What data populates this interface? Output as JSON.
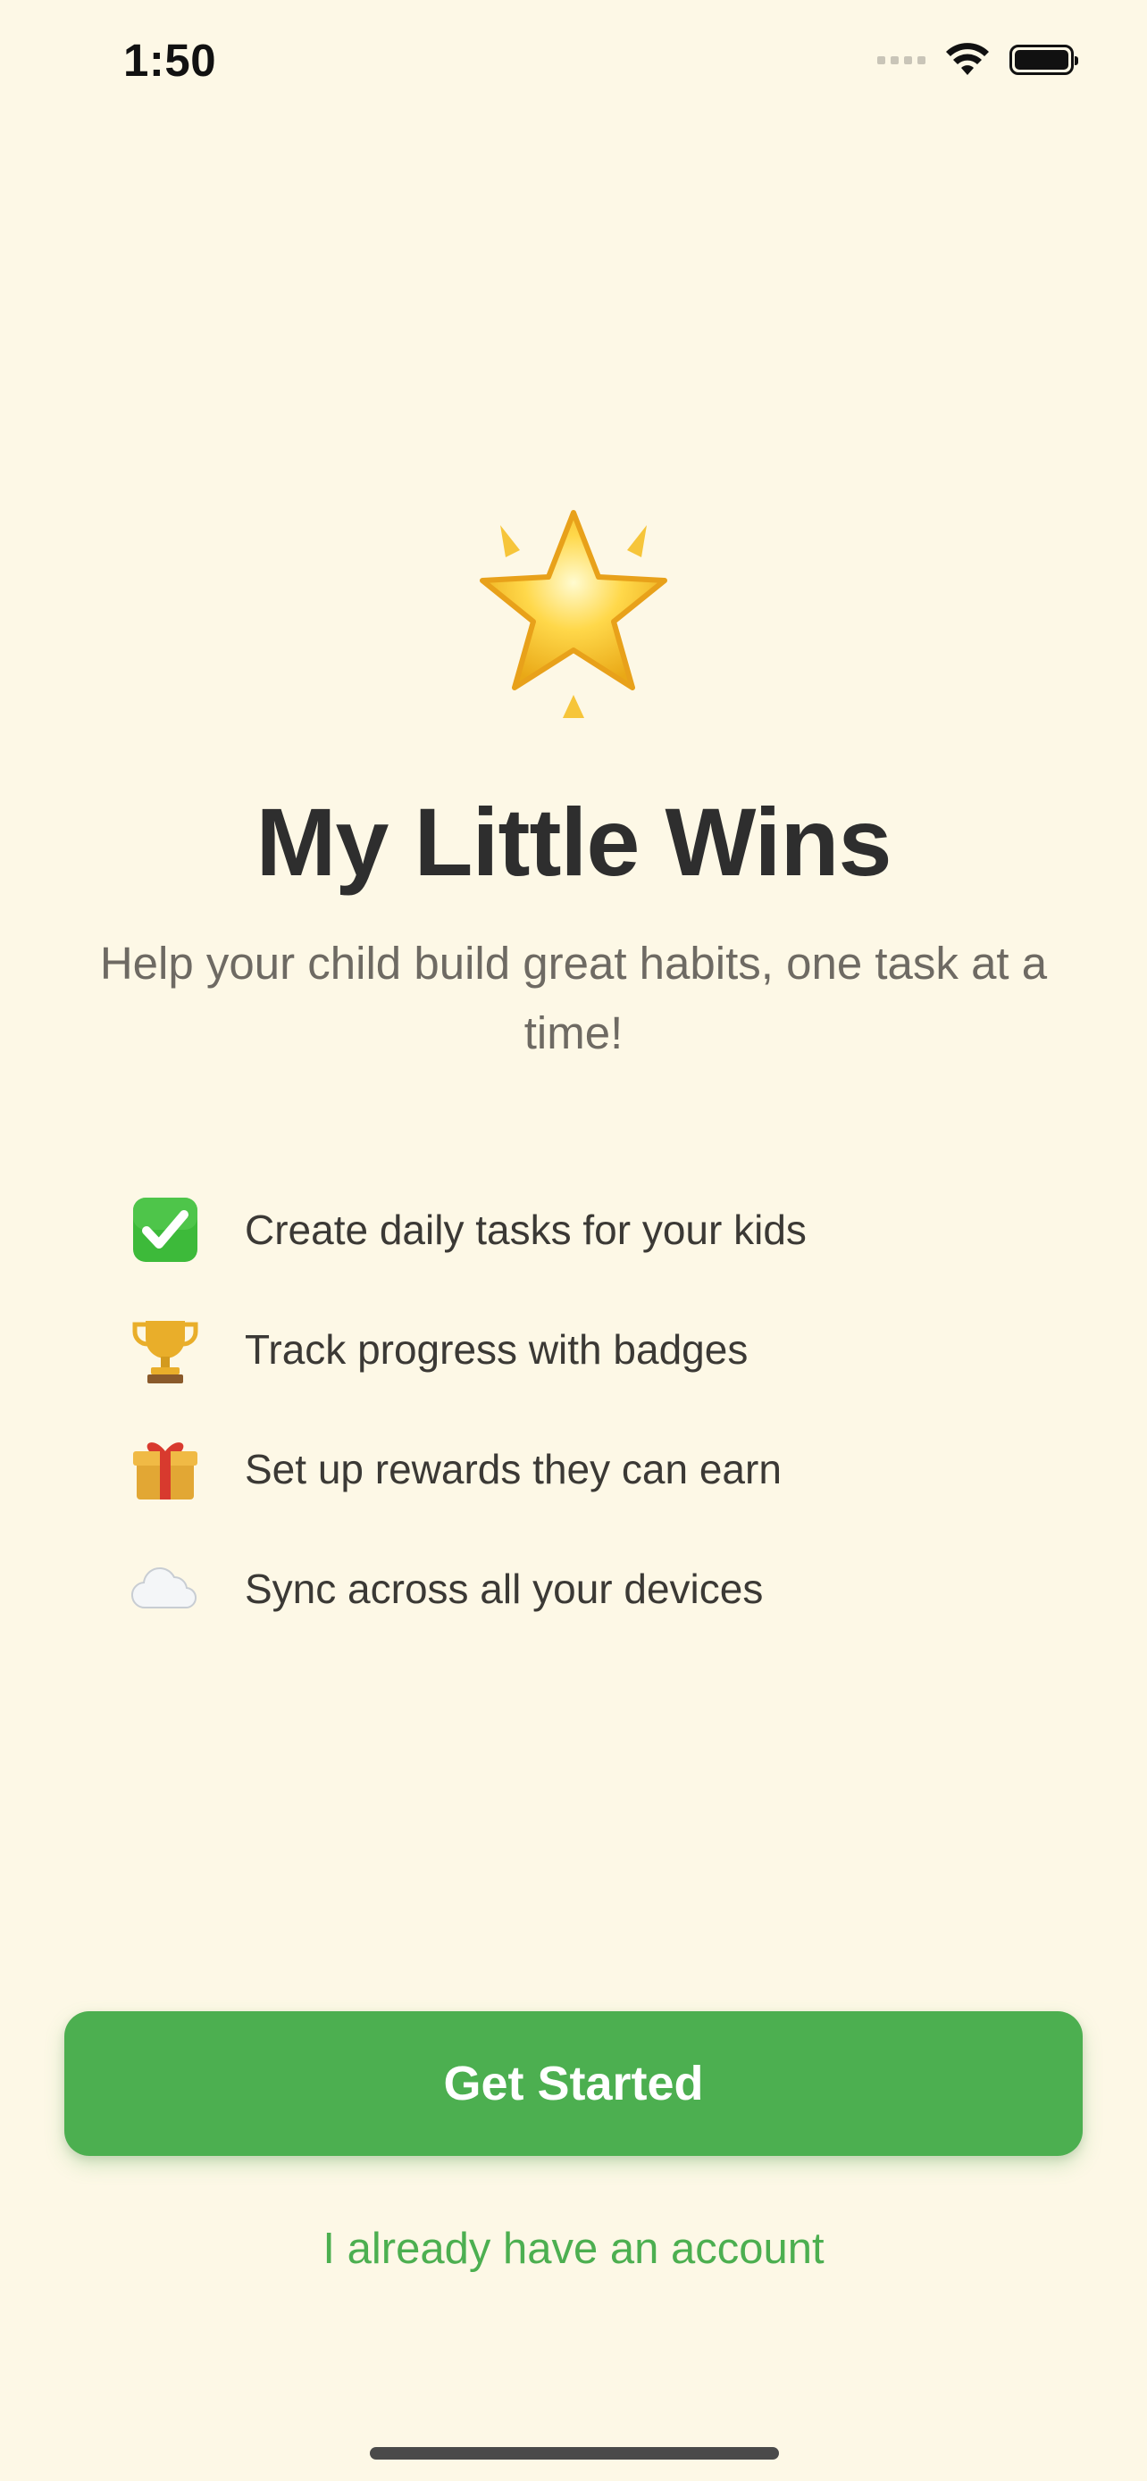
{
  "status_bar": {
    "time": "1:50",
    "icons": [
      "cellular-signal-icon",
      "wifi-icon",
      "battery-icon"
    ]
  },
  "hero": {
    "icon": "glowing-star-icon",
    "title": "My Little Wins",
    "subtitle": "Help your child build great habits, one task at a time!"
  },
  "features": [
    {
      "icon": "check-mark-icon",
      "label": "Create daily tasks for your kids"
    },
    {
      "icon": "trophy-icon",
      "label": "Track progress with badges"
    },
    {
      "icon": "gift-icon",
      "label": "Set up rewards they can earn"
    },
    {
      "icon": "cloud-icon",
      "label": "Sync across all your devices"
    }
  ],
  "actions": {
    "primary_label": "Get Started",
    "secondary_label": "I already have an account"
  },
  "colors": {
    "background": "#FDF8E6",
    "accent": "#4CAF50",
    "title": "#2E2E2E",
    "subtitle": "#6E6A63"
  }
}
